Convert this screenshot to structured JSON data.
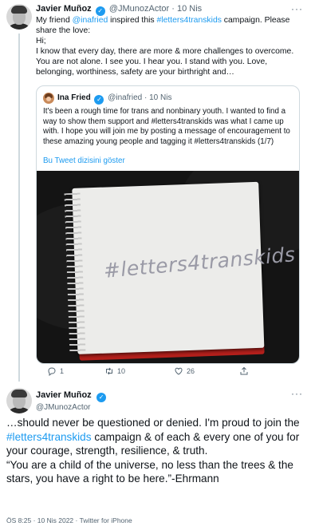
{
  "thread_tweet": {
    "author_name": "Javier Muñoz",
    "handle": "@JMunozActor",
    "date": "10 Nis",
    "separator": "·",
    "body": {
      "line1_pre": "My friend ",
      "line1_mention": "@inafried",
      "line1_mid": " inspired this ",
      "line1_hashtag": "#letters4transkids",
      "line1_post": " campaign. Please share the love:",
      "line2": "Hi;",
      "line3": "I know that every day, there are more & more challenges to overcome. You are not alone. I see you. I hear you. I stand with you. Love, belonging, worthiness, safety are your birthright and…"
    },
    "quote": {
      "author_name": "Ina Fried",
      "handle": "@inafried",
      "date": "10 Nis",
      "text": "It's been a rough time for trans and nonbinary youth. I wanted to find a way to show them support and #letters4transkids was what I came up with. I hope you will join me by posting a message of encouragement to these amazing young people and tagging it #letters4transkids (1/7)",
      "show_thread": "Bu Tweet dizisini göster",
      "image_handwriting": "#letters4transkids"
    },
    "actions": {
      "reply_count": "1",
      "retweet_count": "10",
      "like_count": "26"
    }
  },
  "focused_tweet": {
    "author_name": "Javier Muñoz",
    "handle": "@JMunozActor",
    "body_part1": "…should never be questioned or denied. I'm proud to join the ",
    "body_hashtag": "#letters4transkids",
    "body_part2": " campaign & of each & every one of you for your courage, strength, resilience, & truth.",
    "body_quote": "“You are a child of the universe, no less than the trees & the stars, you have a right to be here.”-Ehrmann",
    "time": "ÖS 8:25",
    "date": "10 Nis 2022",
    "source": "Twitter for iPhone"
  },
  "icons": [
    "more-icon",
    "verified-icon",
    "reply-icon",
    "retweet-icon",
    "like-icon",
    "share-icon"
  ],
  "colors": {
    "accent": "#1d9bf0",
    "text": "#0f1419",
    "muted": "#536471",
    "border": "#cfd9de"
  }
}
